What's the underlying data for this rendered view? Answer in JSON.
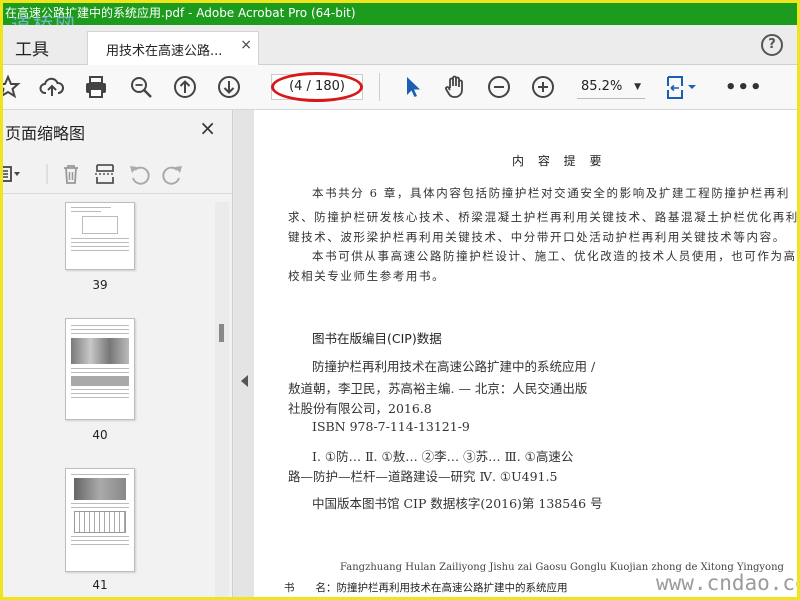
{
  "window": {
    "title": "在高速公路扩建中的系统应用.pdf - Adobe Acrobat Pro (64-bit)",
    "watermark_top": "道桥网"
  },
  "tabs": {
    "tools_label": "工具",
    "doc_label": "用技术在高速公路...",
    "close_glyph": "×",
    "help_glyph": "?"
  },
  "toolbar": {
    "page_indicator": "(4 / 180)",
    "zoom": "85.2%",
    "more_glyph": "•••"
  },
  "sidebar": {
    "title": "页面缩略图",
    "close_glyph": "×",
    "thumbnails": [
      {
        "label": "39"
      },
      {
        "label": "40"
      },
      {
        "label": "41"
      }
    ]
  },
  "document": {
    "summary_title": "内 容 提 要",
    "summary_lines": [
      "本书共分 6 章，具体内容包括防撞护栏对交通安全的影响及扩建工程防撞护栏再利",
      "求、防撞护栏研发核心技术、桥梁混凝土护栏再利用关键技术、路基混凝土护栏优化再利",
      "键技术、波形梁护栏再利用关键技术、中分带开口处活动护栏再利用关键技术等内容。",
      "本书可供从事高速公路防撞护栏设计、施工、优化改造的技术人员使用，也可作为高",
      "校相关专业师生参考用书。"
    ],
    "cip_title": "图书在版编目(CIP)数据",
    "cip_lines": [
      "防撞护栏再利用技术在高速公路扩建中的系统应用 /",
      "敖道朝，李卫民，苏高裕主编. — 北京：人民交通出版",
      "社股份有限公司，2016.8",
      "ISBN  978-7-114-13121-9",
      "Ⅰ. ①防…  Ⅱ. ①敖… ②李… ③苏…  Ⅲ. ①高速公",
      "路—防护—栏杆—道路建设—研究  Ⅳ. ①U491.5",
      "中国版本图书馆 CIP 数据核字(2016)第 138546 号"
    ],
    "footer_pinyin": "Fangzhuang Hulan Zailiyong Jishu zai Gaosu Gonglu Kuojian zhong de Xitong Yingyong",
    "footer_line": "书　　名：防撞护栏再利用技术在高速公路扩建中的系统应用"
  },
  "watermark_bottom": "www.cndao.com",
  "colors": {
    "titlebar": "#1d9b1d",
    "highlight_oval": "#d81818",
    "accent_blue": "#1a5fb4",
    "frame_border": "#f0e41c"
  }
}
